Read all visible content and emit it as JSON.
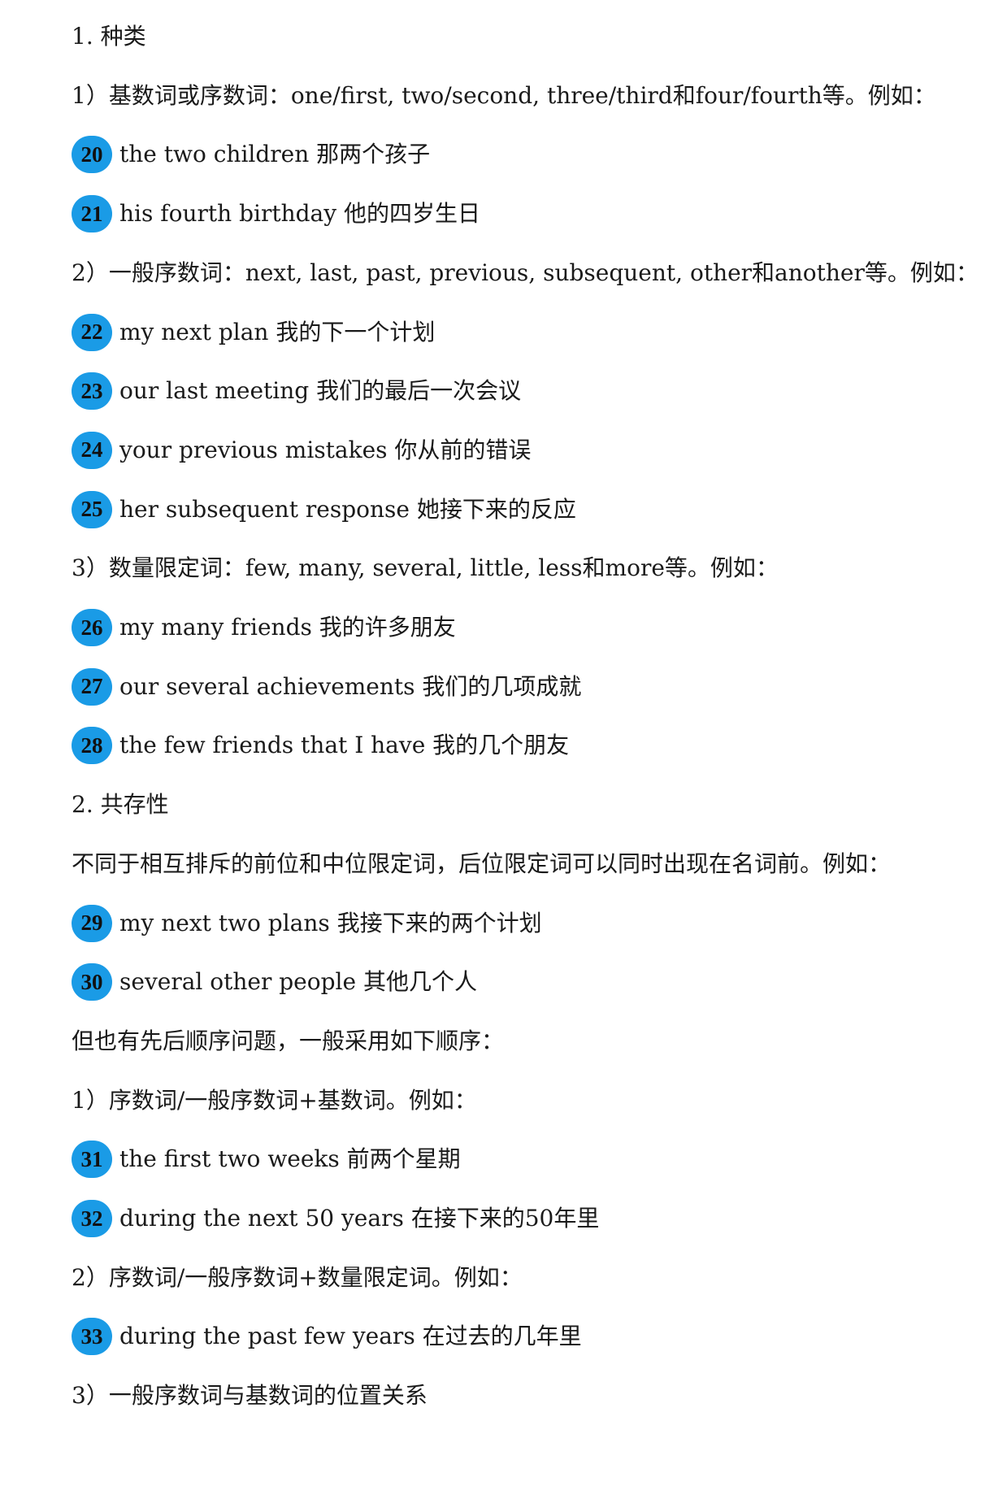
{
  "accent_color": "#1a9be6",
  "lines": [
    {
      "kind": "heading",
      "text": "1. 种类"
    },
    {
      "kind": "text",
      "text": "1）基数词或序数词：one/first, two/second, three/third和four/fourth等。例如："
    },
    {
      "kind": "example",
      "num": "20",
      "text": "the two children 那两个孩子"
    },
    {
      "kind": "example",
      "num": "21",
      "text": "his fourth birthday 他的四岁生日"
    },
    {
      "kind": "text",
      "text": "2）一般序数词：next, last, past, previous, subsequent, other和another等。例如："
    },
    {
      "kind": "example",
      "num": "22",
      "text": "my next plan 我的下一个计划"
    },
    {
      "kind": "example",
      "num": "23",
      "text": "our last meeting 我们的最后一次会议"
    },
    {
      "kind": "example",
      "num": "24",
      "text": "your previous mistakes 你从前的错误"
    },
    {
      "kind": "example",
      "num": "25",
      "text": "her subsequent response 她接下来的反应"
    },
    {
      "kind": "text",
      "text": "3）数量限定词：few, many, several, little, less和more等。例如："
    },
    {
      "kind": "example",
      "num": "26",
      "text": "my many friends 我的许多朋友"
    },
    {
      "kind": "example",
      "num": "27",
      "text": "our several achievements 我们的几项成就"
    },
    {
      "kind": "example",
      "num": "28",
      "text": "the few friends that I have 我的几个朋友"
    },
    {
      "kind": "heading",
      "text": "2. 共存性"
    },
    {
      "kind": "text",
      "text": "不同于相互排斥的前位和中位限定词，后位限定词可以同时出现在名词前。例如："
    },
    {
      "kind": "example",
      "num": "29",
      "text": "my next two plans 我接下来的两个计划"
    },
    {
      "kind": "example",
      "num": "30",
      "text": "several other people 其他几个人"
    },
    {
      "kind": "text",
      "text": "但也有先后顺序问题，一般采用如下顺序："
    },
    {
      "kind": "text",
      "text": "1）序数词/一般序数词+基数词。例如："
    },
    {
      "kind": "example",
      "num": "31",
      "text": "the first two weeks 前两个星期"
    },
    {
      "kind": "example",
      "num": "32",
      "text": "during the next 50 years 在接下来的50年里"
    },
    {
      "kind": "text",
      "text": "2）序数词/一般序数词+数量限定词。例如："
    },
    {
      "kind": "example",
      "num": "33",
      "text": "during the past few years 在过去的几年里"
    },
    {
      "kind": "text",
      "text": "3）一般序数词与基数词的位置关系"
    }
  ]
}
